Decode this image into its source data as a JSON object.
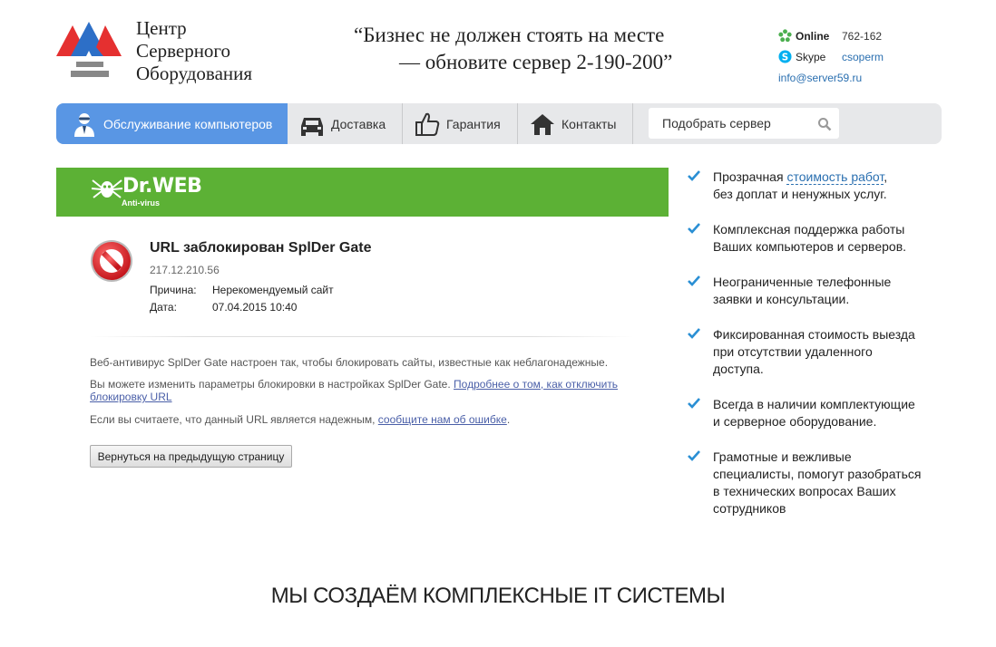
{
  "header": {
    "brand_lines": [
      "Центр",
      "Серверного",
      "Оборудования"
    ],
    "slogan_lines": [
      "“Бизнес не должен стоять на месте",
      "— обновите сервер 2-190-200”"
    ],
    "contacts": {
      "online_label": "Online",
      "online_value": "762-162",
      "skype_label": "Skype",
      "skype_value": "csoperm",
      "email": "info@server59.ru"
    }
  },
  "nav": {
    "items": [
      {
        "label": "Обслуживание компьютеров",
        "icon": "technician-icon"
      },
      {
        "label": "Доставка",
        "icon": "car-icon"
      },
      {
        "label": "Гарантия",
        "icon": "thumbs-up-icon"
      },
      {
        "label": "Контакты",
        "icon": "home-icon"
      }
    ],
    "search_placeholder": "Подобрать сервер"
  },
  "drweb": {
    "name": "Dr.WEB",
    "sub": "Anti-virus",
    "title": "URL заблокирован SplDer Gate",
    "ip": "217.12.210.56",
    "reason_label": "Причина:",
    "reason_value": "Нерекомендуемый сайт",
    "date_label": "Дата:",
    "date_value": "07.04.2015 10:40",
    "p1": "Веб-антивирус SplDer Gate настроен так, чтобы блокировать сайты, известные как неблагонадежные.",
    "p2_text": "Вы можете изменить параметры блокировки в настройках SplDer Gate. ",
    "p2_link_a": "Подробнее о том, как отключить",
    "p2_link_b": "блокировку URL",
    "p3_text": "Если вы считаете, что данный URL является надежным, ",
    "p3_link": "сообщите нам об ошибке",
    "p3_end": ".",
    "back_button": "Вернуться на предыдущую страницу"
  },
  "features": [
    {
      "pre": "Прозрачная ",
      "link": "стоимость работ",
      "post": ",",
      "lines": [
        "без доплат и ненужных услуг."
      ]
    },
    {
      "lines": [
        "Комплексная поддержка работы",
        "Ваших компьютеров и серверов."
      ]
    },
    {
      "lines": [
        "Неограниченные телефонные",
        "заявки и консультации."
      ]
    },
    {
      "lines": [
        "Фиксированная стоимость выезда",
        "при отсутствии удаленного",
        "доступа."
      ]
    },
    {
      "lines": [
        "Всегда в наличии комплектующие",
        "и серверное оборудование."
      ]
    },
    {
      "lines": [
        "Грамотные и вежливые",
        "специалисты, помогут разобраться",
        "в технических вопросах Ваших",
        "сотрудников"
      ]
    }
  ],
  "bottom_heading": "МЫ СОЗДАЁМ КОМПЛЕКСНЫЕ IT СИСТЕМЫ",
  "colors": {
    "accent": "#5996e4",
    "drweb_green": "#5cb135",
    "check": "#2a8fd4",
    "logo_red": "#e53030",
    "logo_blue": "#2d6fc7"
  }
}
